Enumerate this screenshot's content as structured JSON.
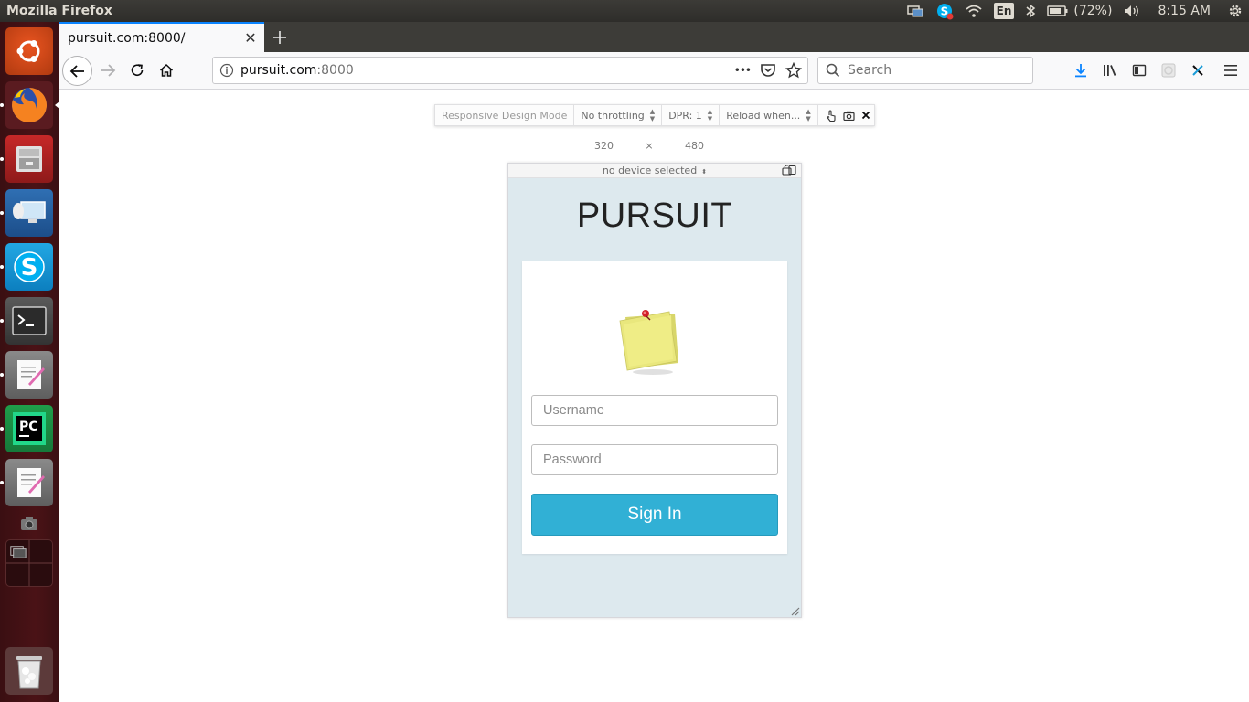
{
  "topbar": {
    "app_title": "Mozilla Firefox",
    "keyboard_layout": "En",
    "battery": "(72%)",
    "clock": "8:15 AM"
  },
  "launcher": {
    "items": [
      "ubuntu-dash",
      "firefox",
      "file-manager",
      "remote-desktop",
      "skype",
      "terminal",
      "text-editor",
      "pycharm",
      "text-editor-2",
      "screenshot",
      "workspace-switcher",
      "trash"
    ]
  },
  "browser": {
    "tab_title": "pursuit.com:8000/",
    "url_host": "pursuit.com",
    "url_port": ":8000",
    "search_placeholder": "Search",
    "url_dots": "•••"
  },
  "rdm": {
    "title": "Responsive Design Mode",
    "throttling": "No throttling",
    "dpr": "DPR: 1",
    "reload": "Reload when...",
    "width": "320",
    "times": "×",
    "height": "480",
    "device": "no device selected"
  },
  "site": {
    "title": "PURSUIT",
    "username_placeholder": "Username",
    "password_placeholder": "Password",
    "signin_label": "Sign In",
    "accent": "#31b0d5",
    "background": "#dde9ee"
  }
}
